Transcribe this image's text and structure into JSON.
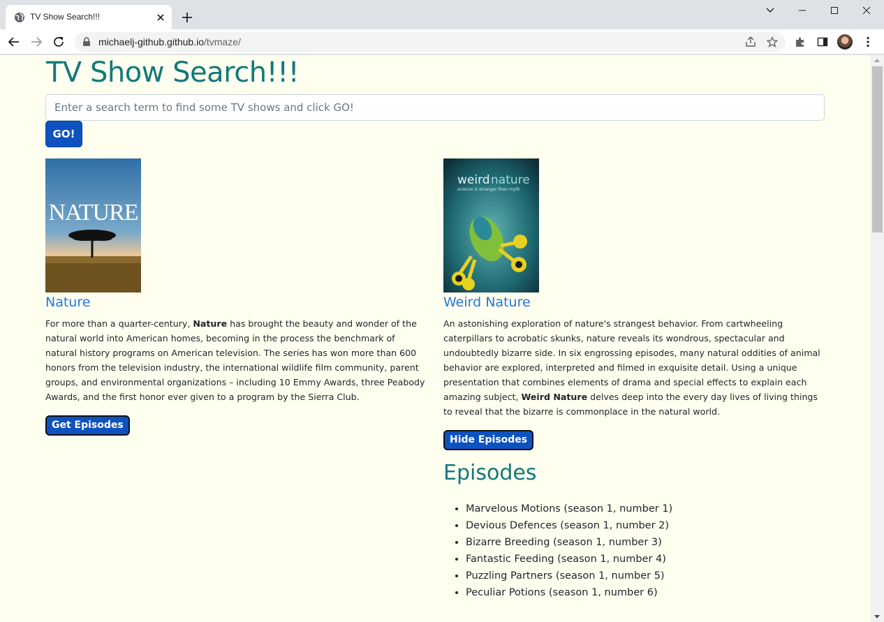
{
  "browser": {
    "tab_title": "TV Show Search!!!",
    "url_host": "michaelj-github.github.io",
    "url_path": "/tvmaze/"
  },
  "page": {
    "title": "TV Show Search!!!",
    "search": {
      "placeholder": "Enter a search term to find some TV shows and click GO!",
      "value": ""
    },
    "go_label": "GO!"
  },
  "shows": [
    {
      "name": "Nature",
      "poster_text": "NATURE",
      "summary_before": "For more than a quarter-century, ",
      "summary_bold": "Nature",
      "summary_after": " has brought the beauty and wonder of the natural world into American homes, becoming in the process the benchmark of natural history programs on American television. The series has won more than 600 honors from the television industry, the international wildlife film community, parent groups, and environmental organizations – including 10 Emmy Awards, three Peabody Awards, and the first honor ever given to a program by the Sierra Club.",
      "button_label": "Get Episodes"
    },
    {
      "name": "Weird Nature",
      "poster_text_a": "weird",
      "poster_text_b": "nature",
      "poster_tagline": "science is stranger than myth",
      "summary_before": "An astonishing exploration of nature's strangest behavior. From cartwheeling caterpillars to acrobatic skunks, nature reveals its wondrous, spectacular and undoubtedly bizarre side. In six engrossing episodes, many natural oddities of animal behavior are explored, interpreted and filmed in exquisite detail. Using a unique presentation that combines elements of drama and special effects to explain each amazing subject, ",
      "summary_bold": "Weird Nature",
      "summary_after": " delves deep into the every day lives of living things to reveal that the bizarre is commonplace in the natural world.",
      "button_label": "Hide Episodes",
      "episodes_heading": "Episodes",
      "episodes": [
        "Marvelous Motions (season 1, number 1)",
        "Devious Defences (season 1, number 2)",
        "Bizarre Breeding (season 1, number 3)",
        "Fantastic Feeding (season 1, number 4)",
        "Puzzling Partners (season 1, number 5)",
        "Peculiar Potions (season 1, number 6)"
      ]
    }
  ],
  "colors": {
    "page_bg": "#fffff0",
    "title_teal": "#127979",
    "link_blue": "#2176e0",
    "button_blue": "#0d52bf"
  },
  "icons": [
    "globe-icon",
    "close-icon",
    "plus-icon",
    "back-icon",
    "forward-icon",
    "reload-icon",
    "lock-icon",
    "share-icon",
    "star-icon",
    "extensions-icon",
    "side-panel-icon",
    "menu-icon"
  ]
}
